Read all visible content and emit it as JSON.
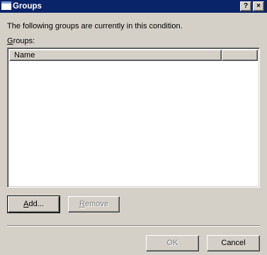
{
  "window": {
    "title": "Groups",
    "help_button": "?",
    "close_button": "×"
  },
  "intro_text": "The following groups are currently in this condition.",
  "groups_label": {
    "mnemonic": "G",
    "rest": "roups:"
  },
  "list": {
    "columns": [
      "Name",
      ""
    ],
    "rows": []
  },
  "buttons": {
    "add": {
      "mnemonic": "A",
      "rest": "dd..."
    },
    "remove": {
      "mnemonic": "R",
      "rest": "emove"
    },
    "ok": "OK",
    "cancel": "Cancel"
  },
  "colors": {
    "titlebar": "#0a246a",
    "dialog_background": "#d4d0c8",
    "disabled_text": "#808080"
  }
}
